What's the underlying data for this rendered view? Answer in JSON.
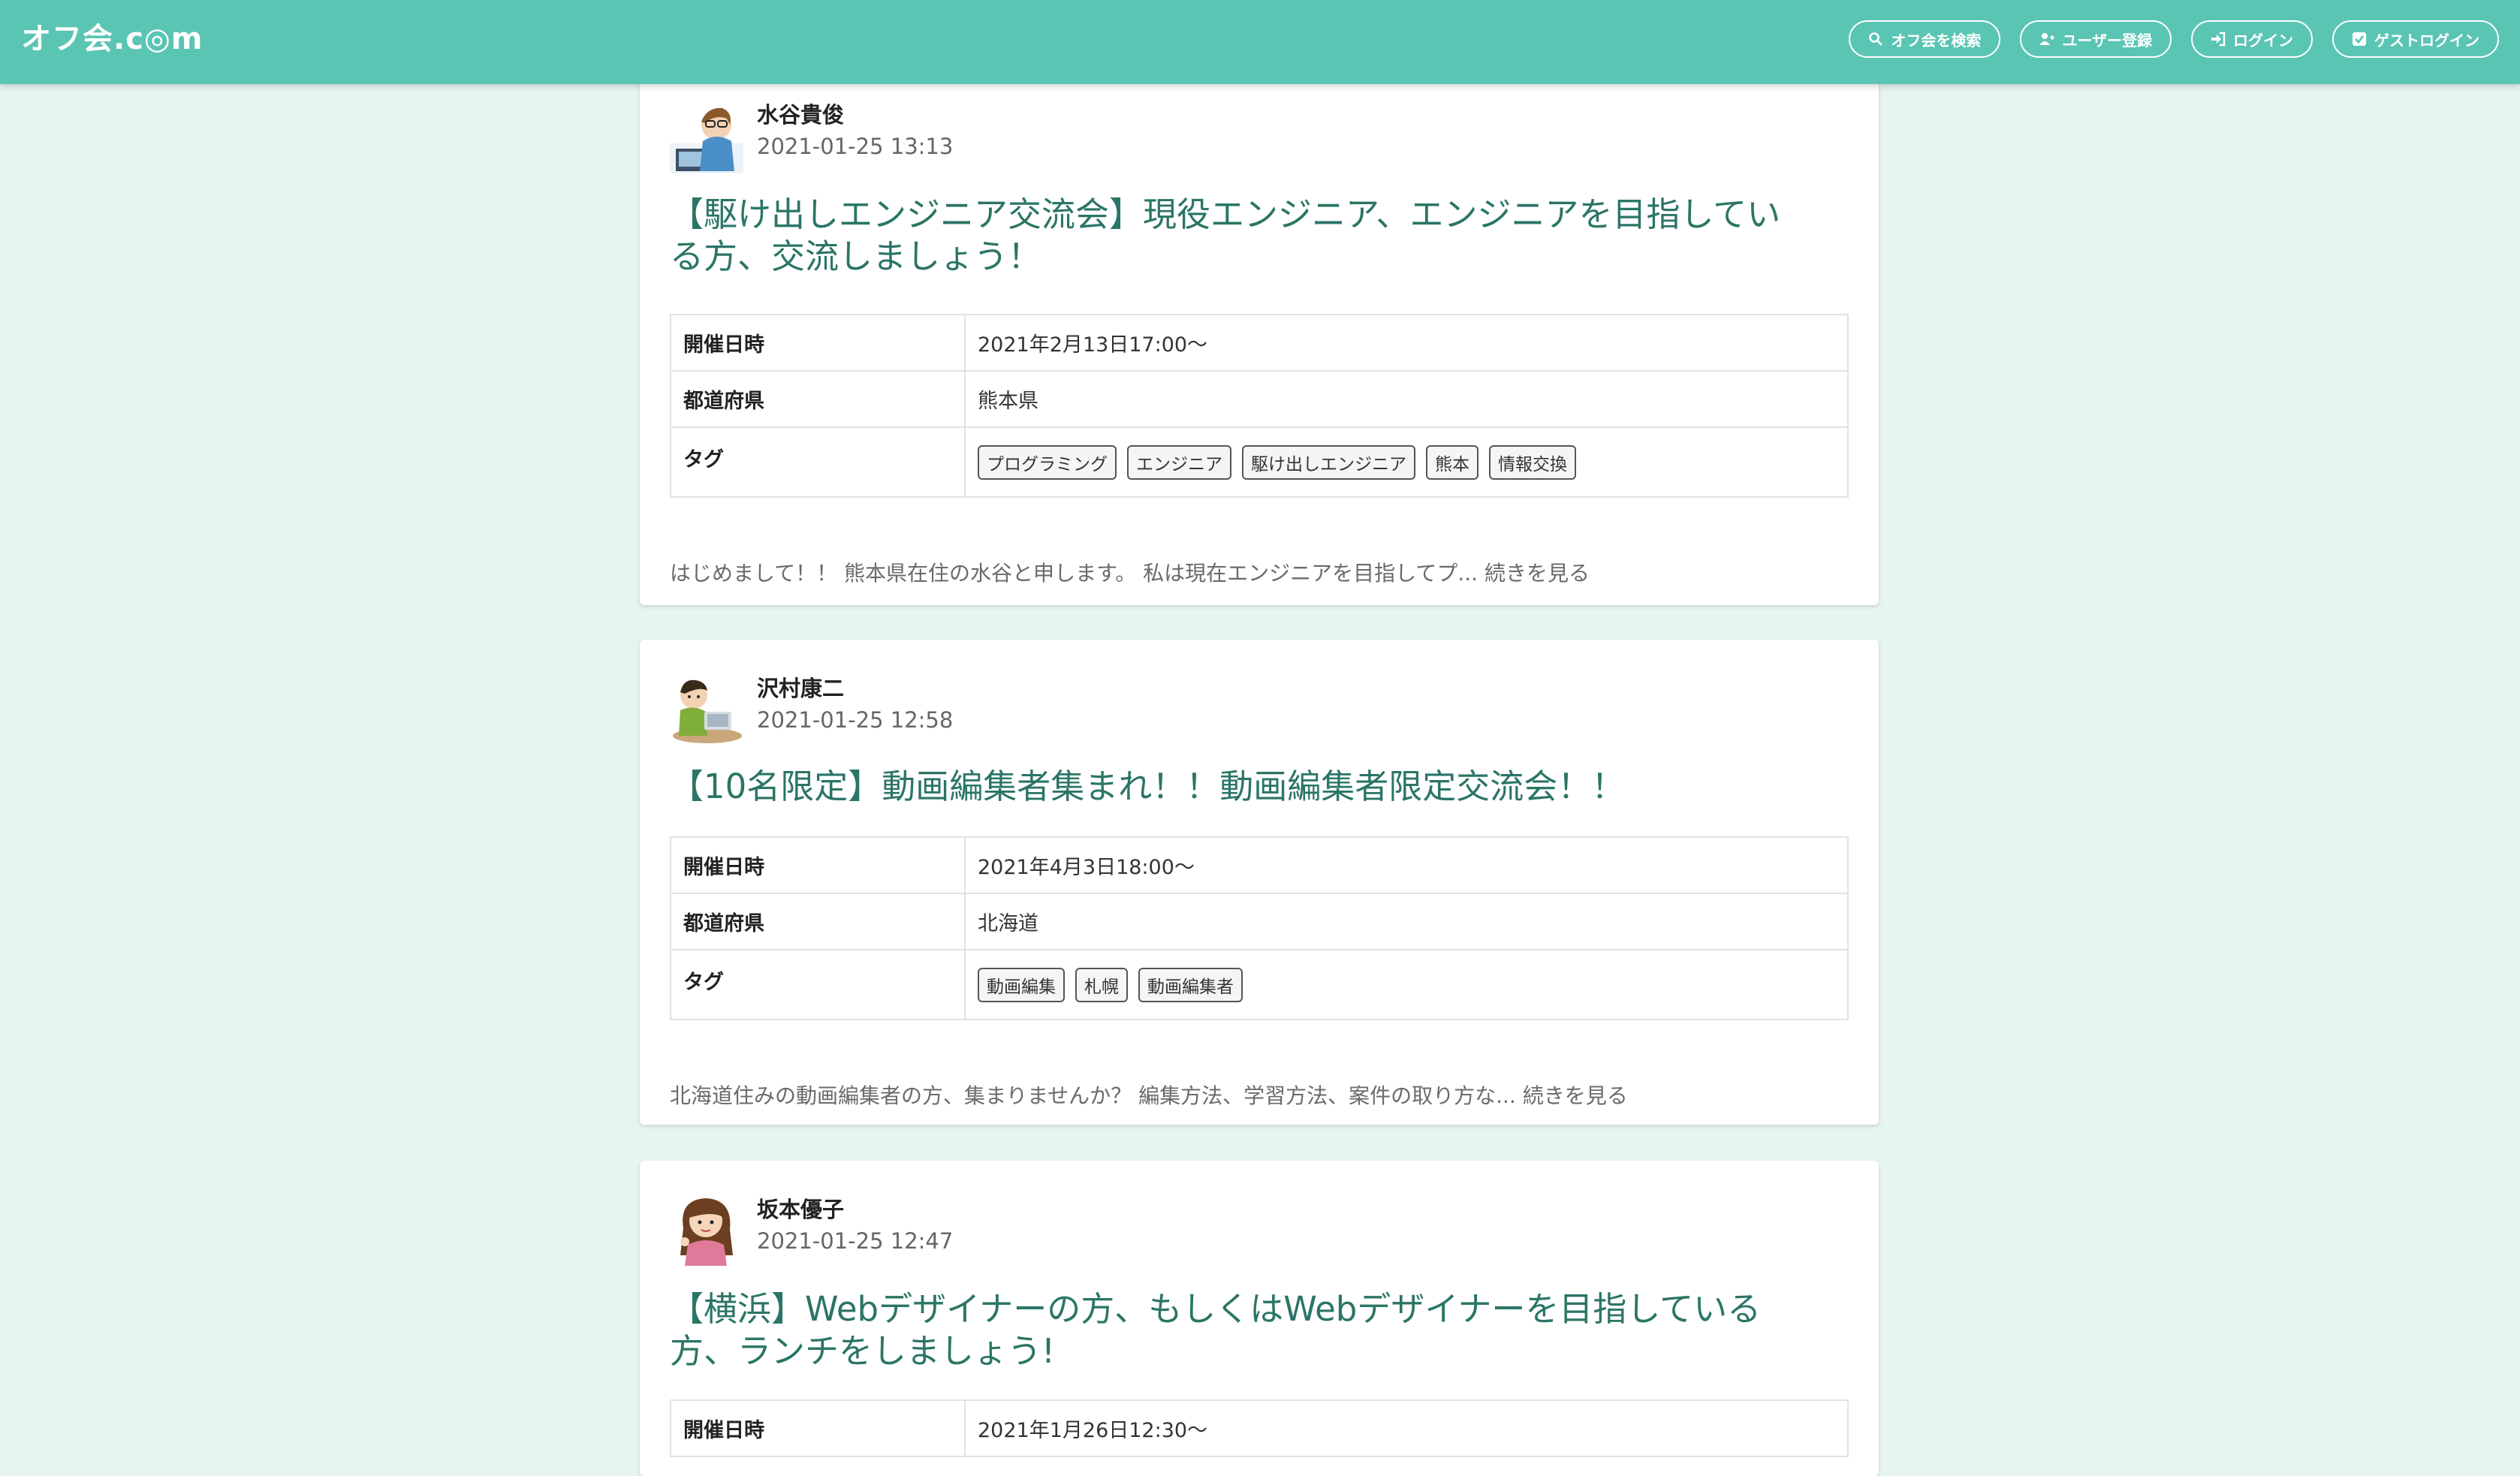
{
  "header": {
    "brand": "オフ会.c◎m",
    "nav": [
      {
        "label": "オフ会を検索",
        "icon": "search-icon"
      },
      {
        "label": "ユーザー登録",
        "icon": "user-plus-icon"
      },
      {
        "label": "ログイン",
        "icon": "sign-in-icon"
      },
      {
        "label": "ゲストログイン",
        "icon": "check-square-icon"
      }
    ]
  },
  "labels": {
    "date": "開催日時",
    "prefecture": "都道府県",
    "tags": "タグ",
    "read_more": "続きを見る"
  },
  "posts": [
    {
      "author": "水谷貴俊",
      "posted_at": "2021-01-25 13:13",
      "title_line1": "【駆け出しエンジニア交流会】現役エンジニア、エンジニアを目指してい",
      "title_line2": "る方、交流しましょう！",
      "event_date": "2021年2月13日17:00〜",
      "prefecture": "熊本県",
      "tags": [
        "プログラミング",
        "エンジニア",
        "駆け出しエンジニア",
        "熊本",
        "情報交換"
      ],
      "excerpt": "はじめまして！！ 熊本県在住の水谷と申します。 私は現在エンジニアを目指してプ..."
    },
    {
      "author": "沢村康二",
      "posted_at": "2021-01-25 12:58",
      "title_line1": "【10名限定】動画編集者集まれ！！動画編集者限定交流会！！",
      "title_line2": "",
      "event_date": "2021年4月3日18:00〜",
      "prefecture": "北海道",
      "tags": [
        "動画編集",
        "札幌",
        "動画編集者"
      ],
      "excerpt": "北海道住みの動画編集者の方、集まりませんか？ 編集方法、学習方法、案件の取り方な..."
    },
    {
      "author": "坂本優子",
      "posted_at": "2021-01-25 12:47",
      "title_line1": "【横浜】Webデザイナーの方、もしくはWebデザイナーを目指している",
      "title_line2": "方、ランチをしましょう!",
      "event_date": "2021年1月26日12:30〜"
    }
  ],
  "colors": {
    "navbar": "#5bc5b3",
    "background": "#e6f5f1",
    "title": "#2b7566"
  }
}
